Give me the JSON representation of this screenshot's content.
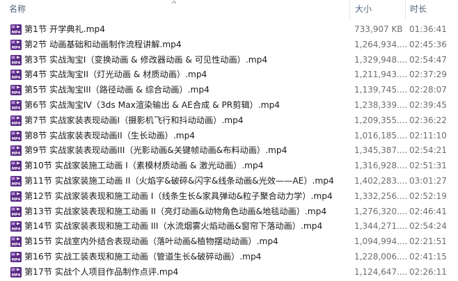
{
  "columns": {
    "name": "名称",
    "size": "大小",
    "duration": "时长"
  },
  "icons": {
    "file": "mp4-video-icon",
    "sort": "sort-asc-icon"
  },
  "colors": {
    "icon_bg": "#5b2b86",
    "icon_text": "#ffffff",
    "header_text": "#4c607a"
  },
  "files": [
    {
      "name": "第1节 开学典礼.mp4",
      "size": "733,907 KB",
      "duration": "01:36:41"
    },
    {
      "name": "第2节 动画基础和动画制作流程讲解.mp4",
      "size": "1,264,934....",
      "duration": "02:45:36"
    },
    {
      "name": "第3节 实战淘宝I（变换动画 & 修改器动画 & 可见性动画）.mp4",
      "size": "1,329,948....",
      "duration": "02:54:47"
    },
    {
      "name": "第4节 实战淘宝II（灯光动画 & 材质动画）.mp4",
      "size": "1,211,943....",
      "duration": "02:37:29"
    },
    {
      "name": "第5节 实战淘宝III（路径动画 & 综合动画）.mp4",
      "size": "1,139,745....",
      "duration": "02:28:07"
    },
    {
      "name": "第6节 实战淘宝IV（3ds Max渲染输出 & AE合成 & PR剪辑）.mp4",
      "size": "1,238,339....",
      "duration": "02:39:45"
    },
    {
      "name": "第7节 实战家装表现动画I（摄影机飞行和抖动动画）.mp4",
      "size": "1,209,355....",
      "duration": "02:36:22"
    },
    {
      "name": "第8节 实战家装表现动画II（生长动画）.mp4",
      "size": "1,016,185....",
      "duration": "02:11:10"
    },
    {
      "name": "第9节 实战家装表现动画III（光影动画&关键帧动画&布料动画）.mp4",
      "size": "1,345,387....",
      "duration": "02:54:21"
    },
    {
      "name": "第10节 实战家装施工动画 I（素模材质动画 & 激光动画）.mp4",
      "size": "1,316,928....",
      "duration": "02:51:31"
    },
    {
      "name": "第11节 实战家装施工动画 II（火焰字&破碎&闪字&线条动画&光效——AE）.mp4",
      "size": "1,402,283....",
      "duration": "03:01:27"
    },
    {
      "name": "第12节 实战家装表现和施工动画 I（线条生长&家具弹动&粒子聚合动力学）.mp4",
      "size": "1,332,256....",
      "duration": "02:52:19"
    },
    {
      "name": "第13节 实战家装表现和施工动画 II（亮灯动画&动物角色动画&地毯动画）.mp4",
      "size": "1,276,320....",
      "duration": "02:46:41"
    },
    {
      "name": "第14节 实战家装表现和施工动画 III（水流烟雾火焰动画&窗帘下落动画）.mp4",
      "size": "1,344,271....",
      "duration": "02:54:24"
    },
    {
      "name": "第15节 实战室内外结合表现动画（落叶动画&植物摆动动画）.mp4",
      "size": "1,094,994....",
      "duration": "02:21:51"
    },
    {
      "name": "第16节 实战工装表现和施工动画（管道生长&破碎动画）.mp4",
      "size": "1,228,006....",
      "duration": "02:41:15"
    },
    {
      "name": "第17节 实战个人项目作品制作点评.mp4",
      "size": "1,124,647....",
      "duration": "02:26:11"
    }
  ]
}
